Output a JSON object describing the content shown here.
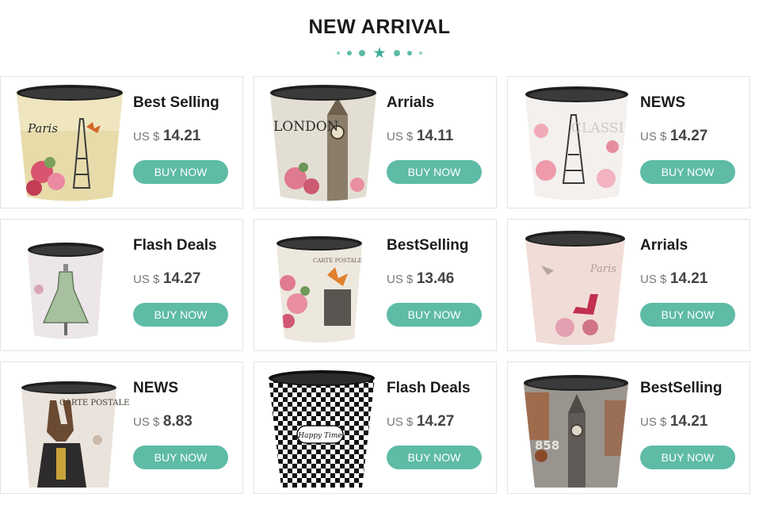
{
  "header": {
    "title": "NEW ARRIVAL"
  },
  "colors": {
    "accent": "#5ebba6",
    "title": "#1a1a1a"
  },
  "products": [
    {
      "name": "Best Selling",
      "currency": "US $",
      "price": "14.21",
      "button": "BUY NOW",
      "image": "paris-eiffel-bin",
      "image_text": "Paris"
    },
    {
      "name": "Arrials",
      "currency": "US $",
      "price": "14.11",
      "button": "BUY NOW",
      "image": "london-bigben-bin",
      "image_text": "LONDON"
    },
    {
      "name": "NEWS",
      "currency": "US $",
      "price": "14.27",
      "button": "BUY NOW",
      "image": "classic-eiffel-bin",
      "image_text": "CLASSI"
    },
    {
      "name": "Flash Deals",
      "currency": "US $",
      "price": "14.27",
      "button": "BUY NOW",
      "image": "dress-bin",
      "image_text": ""
    },
    {
      "name": "BestSelling",
      "currency": "US $",
      "price": "13.46",
      "button": "BUY NOW",
      "image": "carte-postale-butterfly-bin",
      "image_text": "CARTE POSTALE"
    },
    {
      "name": "Arrials",
      "currency": "US $",
      "price": "14.21",
      "button": "BUY NOW",
      "image": "paris-shoe-bin",
      "image_text": "Paris"
    },
    {
      "name": "NEWS",
      "currency": "US $",
      "price": "8.83",
      "button": "BUY NOW",
      "image": "rabbit-soldier-bin",
      "image_text": "CARTE POSTALE"
    },
    {
      "name": "Flash Deals",
      "currency": "US $",
      "price": "14.27",
      "button": "BUY NOW",
      "image": "checkered-bin",
      "image_text": "Happy Time"
    },
    {
      "name": "BestSelling",
      "currency": "US $",
      "price": "14.21",
      "button": "BUY NOW",
      "image": "rusty-london-bin",
      "image_text": "858"
    }
  ]
}
